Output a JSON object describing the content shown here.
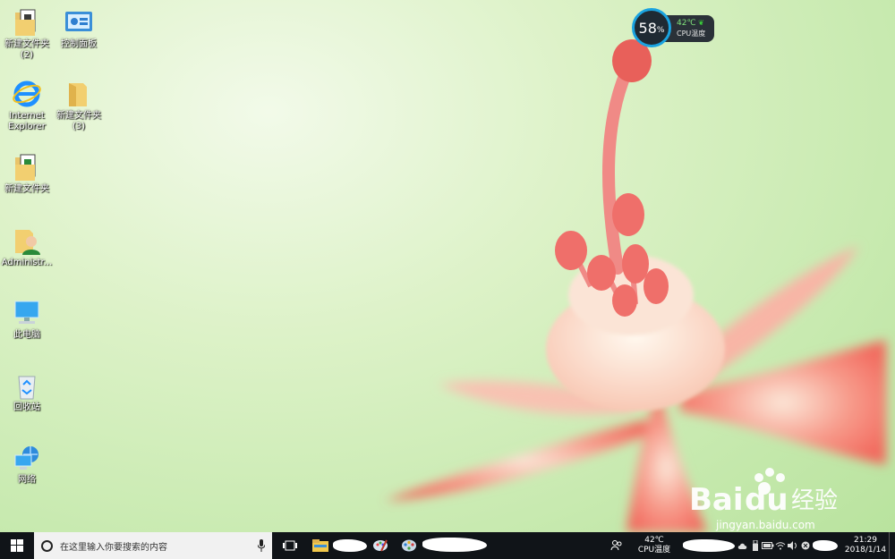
{
  "desktop": {
    "icons": [
      {
        "id": "folder-2",
        "label": "新建文件夹\n(2)"
      },
      {
        "id": "control-panel",
        "label": "控制面板"
      },
      {
        "id": "ie",
        "label": "Internet\nExplorer"
      },
      {
        "id": "folder-3",
        "label": "新建文件夹\n(3)"
      },
      {
        "id": "folder",
        "label": "新建文件夹"
      },
      {
        "id": "admin",
        "label": "Administr..."
      },
      {
        "id": "this-pc",
        "label": "此电脑"
      },
      {
        "id": "recycle",
        "label": "回收站"
      },
      {
        "id": "network",
        "label": "网络"
      }
    ]
  },
  "cpu_widget": {
    "usage": "58",
    "usage_unit": "%",
    "temp": "42℃",
    "label": "CPU温度"
  },
  "taskbar": {
    "search_placeholder": "在这里输入你要搜索的内容",
    "tray_temp": "42℃",
    "tray_temp_label": "CPU温度",
    "time": "21:29",
    "date": "2018/1/14"
  },
  "watermark": {
    "url": "jingyan.baidu.com"
  },
  "colors": {
    "taskbar": "#101418",
    "accent": "#1aa3e0",
    "search_bg": "#f1f1f1"
  }
}
